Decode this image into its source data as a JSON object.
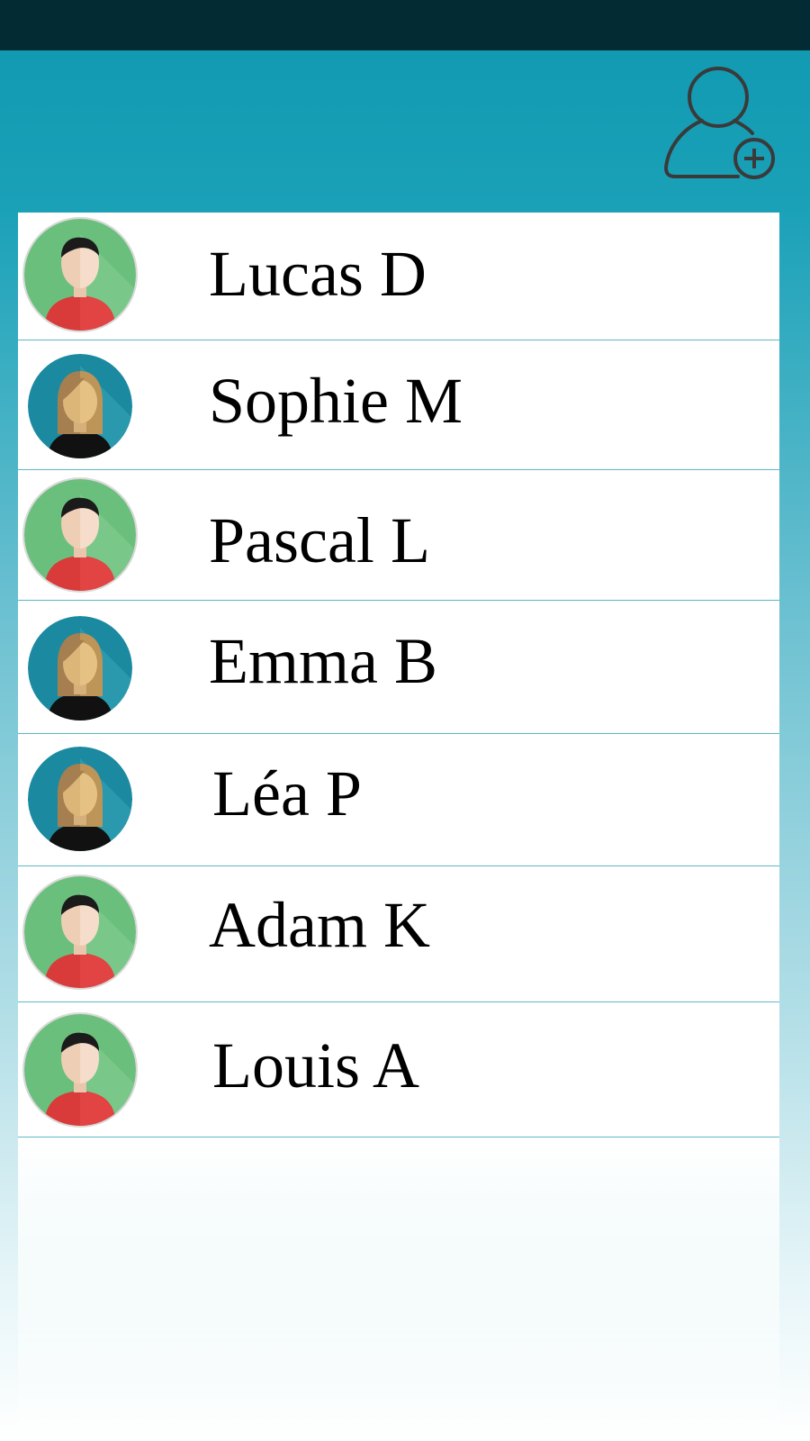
{
  "header": {
    "add_user_icon": "add-user-icon"
  },
  "contacts": [
    {
      "name": "Lucas D",
      "avatar": "male"
    },
    {
      "name": "Sophie M",
      "avatar": "female"
    },
    {
      "name": "Pascal L",
      "avatar": "male"
    },
    {
      "name": "Emma B",
      "avatar": "female"
    },
    {
      "name": "Léa P",
      "avatar": "female"
    },
    {
      "name": "Adam K",
      "avatar": "male"
    },
    {
      "name": "Louis A",
      "avatar": "male"
    }
  ],
  "colors": {
    "status_bar": "#032b34",
    "header": "#0e98b0",
    "divider": "#5cb9c4",
    "male_avatar_bg": "#6bbf7c",
    "female_avatar_bg": "#1b8aa1"
  }
}
